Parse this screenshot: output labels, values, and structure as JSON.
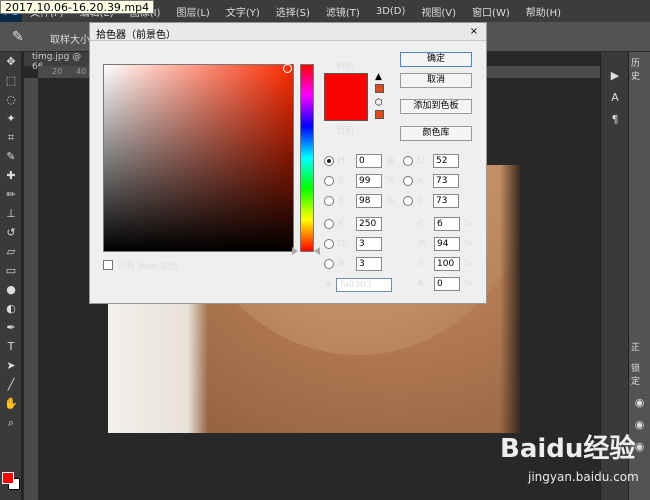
{
  "video_title": "2017.10.06-16.20.39.mp4",
  "app": {
    "logo": "Ps",
    "menu": [
      "文件(F)",
      "编辑(E)",
      "图像(I)",
      "图层(L)",
      "文字(Y)",
      "选择(S)",
      "滤镜(T)",
      "3D(D)",
      "视图(V)",
      "窗口(W)",
      "帮助(H)"
    ]
  },
  "options_bar": {
    "sample_size": "取样大小:"
  },
  "document": {
    "tab": "timg.jpg @ 66"
  },
  "ruler": {
    "ticks": [
      "20",
      "40",
      "60"
    ]
  },
  "dialog": {
    "title": "拾色器（前景色）",
    "close": "×",
    "new_label": "新的",
    "current_label": "当前",
    "new_color": "#fa0303",
    "current_color": "#fa0303",
    "warning_color": "#e04a20",
    "buttons": {
      "ok": "确定",
      "cancel": "取消",
      "add_swatch": "添加到色板",
      "color_library": "颜色库"
    },
    "fields": {
      "H": {
        "label": "H:",
        "value": "0",
        "unit": "度"
      },
      "S": {
        "label": "S:",
        "value": "99",
        "unit": "%"
      },
      "Bv": {
        "label": "B:",
        "value": "98",
        "unit": "%"
      },
      "R": {
        "label": "R:",
        "value": "250",
        "unit": ""
      },
      "G": {
        "label": "G:",
        "value": "3",
        "unit": ""
      },
      "Bc": {
        "label": "B:",
        "value": "3",
        "unit": ""
      },
      "L": {
        "label": "L:",
        "value": "52",
        "unit": ""
      },
      "a": {
        "label": "a:",
        "value": "73",
        "unit": ""
      },
      "b": {
        "label": "b:",
        "value": "73",
        "unit": ""
      },
      "C": {
        "label": "C:",
        "value": "6",
        "unit": "%"
      },
      "M": {
        "label": "M:",
        "value": "94",
        "unit": "%"
      },
      "Y": {
        "label": "Y:",
        "value": "100",
        "unit": "%"
      },
      "K": {
        "label": "K:",
        "value": "0",
        "unit": "%"
      }
    },
    "hex_label": "#",
    "hex_value": "fa0303",
    "web_only": "只有 Web 颜色"
  },
  "right_panel": {
    "tab1": "历史",
    "tab2": "正",
    "tab3": "锁定"
  },
  "watermark": {
    "text": "Baidu经验",
    "url": "jingyan.baidu.com"
  }
}
